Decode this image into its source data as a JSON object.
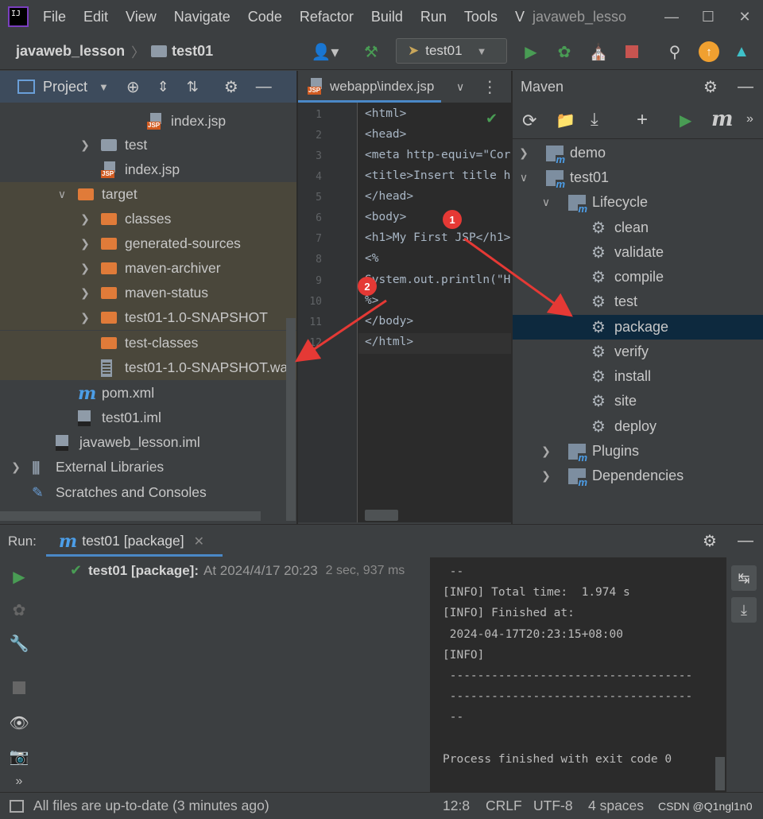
{
  "menubar": {
    "logo": "IJ",
    "items": [
      "File",
      "Edit",
      "View",
      "Navigate",
      "Code",
      "Refactor",
      "Build",
      "Run",
      "Tools",
      "V"
    ],
    "window_title": "javaweb_lesso"
  },
  "navbar": {
    "project": "javaweb_lesson",
    "module": "test01",
    "run_config": "test01"
  },
  "project_panel": {
    "title": "Project",
    "tree": [
      {
        "label": "index.jsp",
        "icon": "jsp-file-icon",
        "indent": 185,
        "arrow": ""
      },
      {
        "label": "test",
        "icon": "folder-icon",
        "indent": 127,
        "arrow": ">"
      },
      {
        "label": "index.jsp",
        "icon": "jsp-file-icon",
        "indent": 127,
        "arrow": ""
      },
      {
        "label": "target",
        "icon": "folder-orange-icon",
        "indent": 98,
        "arrow": "v"
      },
      {
        "label": "classes",
        "icon": "folder-orange-icon",
        "indent": 127,
        "arrow": ">"
      },
      {
        "label": "generated-sources",
        "icon": "folder-orange-icon",
        "indent": 127,
        "arrow": ">"
      },
      {
        "label": "maven-archiver",
        "icon": "folder-orange-icon",
        "indent": 127,
        "arrow": ">"
      },
      {
        "label": "maven-status",
        "icon": "folder-orange-icon",
        "indent": 127,
        "arrow": ">"
      },
      {
        "label": "test01-1.0-SNAPSHOT",
        "icon": "folder-orange-icon",
        "indent": 127,
        "arrow": ">"
      },
      {
        "label": "test-classes",
        "icon": "folder-orange-icon",
        "indent": 127,
        "arrow": ""
      },
      {
        "label": "test01-1.0-SNAPSHOT.war",
        "icon": "war-file-icon",
        "indent": 127,
        "arrow": ""
      },
      {
        "label": "pom.xml",
        "icon": "maven-file-icon",
        "indent": 98,
        "arrow": ""
      },
      {
        "label": "test01.iml",
        "icon": "iml-file-icon",
        "indent": 98,
        "arrow": ""
      },
      {
        "label": "javaweb_lesson.iml",
        "icon": "iml-file-icon",
        "indent": 70,
        "arrow": ""
      },
      {
        "label": "External Libraries",
        "icon": "library-icon",
        "indent": 40,
        "arrow": ">"
      },
      {
        "label": "Scratches and Consoles",
        "icon": "scratch-icon",
        "indent": 40,
        "arrow": ""
      }
    ]
  },
  "editor": {
    "tab": "webapp\\index.jsp",
    "lines": [
      {
        "n": "1",
        "code": "<html>"
      },
      {
        "n": "2",
        "code": "<head>"
      },
      {
        "n": "3",
        "code": "<meta http-equiv=\"Cor"
      },
      {
        "n": "4",
        "code": "<title>Insert title h"
      },
      {
        "n": "5",
        "code": "</head>"
      },
      {
        "n": "6",
        "code": "<body>"
      },
      {
        "n": "7",
        "code": "<h1>My First JSP</h1>"
      },
      {
        "n": "8",
        "code": "<%"
      },
      {
        "n": "9",
        "code": "System.out.println(\"H"
      },
      {
        "n": "10",
        "code": "%>"
      },
      {
        "n": "11",
        "code": "</body>"
      },
      {
        "n": "12",
        "code": "</html>"
      }
    ]
  },
  "maven": {
    "title": "Maven",
    "tree": [
      {
        "label": "demo",
        "arrow": ">",
        "icon": "maven-project-icon",
        "indent": 10
      },
      {
        "label": "test01",
        "arrow": "v",
        "icon": "maven-project-icon",
        "indent": 10
      },
      {
        "label": "Lifecycle",
        "arrow": "v",
        "icon": "lifecycle-folder-icon",
        "indent": 38
      },
      {
        "label": "clean",
        "arrow": "",
        "icon": "gear-icon",
        "indent": 96
      },
      {
        "label": "validate",
        "arrow": "",
        "icon": "gear-icon",
        "indent": 96
      },
      {
        "label": "compile",
        "arrow": "",
        "icon": "gear-icon",
        "indent": 96
      },
      {
        "label": "test",
        "arrow": "",
        "icon": "gear-icon",
        "indent": 96
      },
      {
        "label": "package",
        "arrow": "",
        "icon": "gear-icon",
        "indent": 96,
        "selected": true
      },
      {
        "label": "verify",
        "arrow": "",
        "icon": "gear-icon",
        "indent": 96
      },
      {
        "label": "install",
        "arrow": "",
        "icon": "gear-icon",
        "indent": 96
      },
      {
        "label": "site",
        "arrow": "",
        "icon": "gear-icon",
        "indent": 96
      },
      {
        "label": "deploy",
        "arrow": "",
        "icon": "gear-icon",
        "indent": 96
      },
      {
        "label": "Plugins",
        "arrow": ">",
        "icon": "plugins-folder-icon",
        "indent": 38
      },
      {
        "label": "Dependencies",
        "arrow": ">",
        "icon": "dependencies-folder-icon",
        "indent": 38
      }
    ]
  },
  "run_panel": {
    "label": "Run:",
    "tab": "test01 [package]",
    "task_name": "test01 [package]:",
    "task_time": "At 2024/4/17 20:23",
    "task_duration": "2 sec, 937 ms",
    "console": [
      " --",
      "[INFO] Total time:  1.974 s",
      "[INFO] Finished at:",
      " 2024-04-17T20:23:15+08:00",
      "[INFO]",
      " -----------------------------------",
      " -----------------------------------",
      " --",
      "",
      "Process finished with exit code 0"
    ]
  },
  "statusbar": {
    "message": "All files are up-to-date (3 minutes ago)",
    "position": "12:8",
    "line_sep": "CRLF",
    "encoding": "UTF-8",
    "indent": "4 spaces",
    "watermark": "CSDN @Q1ngl1n0"
  },
  "annotations": {
    "marker1": "1",
    "marker2": "2"
  },
  "colors": {
    "selection": "#0d293e",
    "highlight_rows": "#4a473b",
    "accent_green": "#499c54",
    "red_annotation": "#e53935",
    "orange_folder": "#e07b39"
  }
}
